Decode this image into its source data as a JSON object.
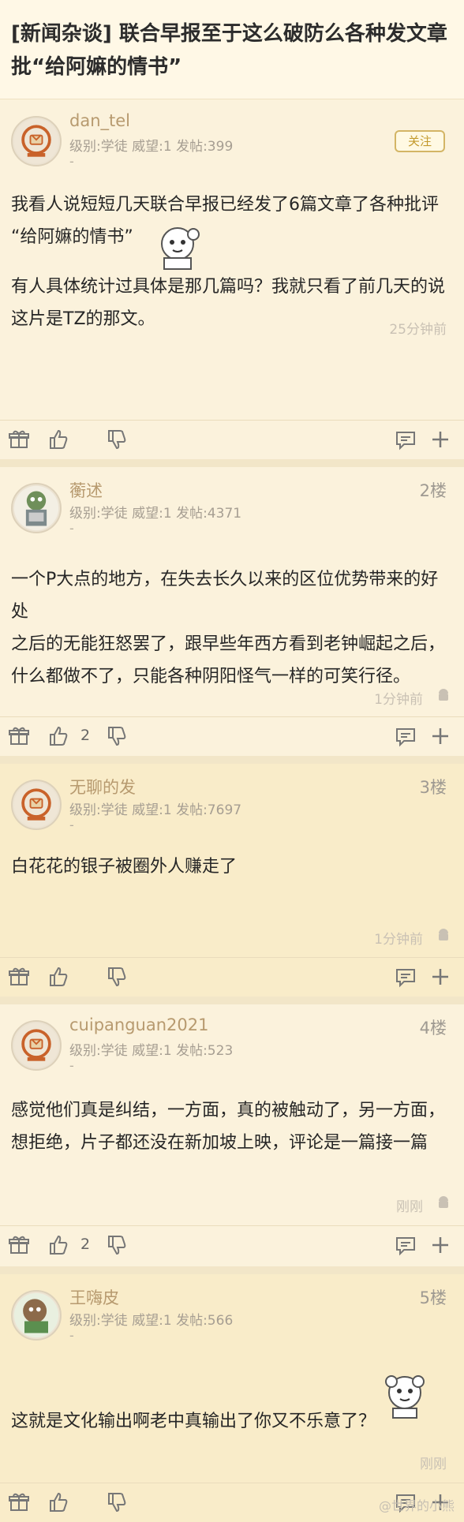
{
  "thread": {
    "title_line1": "[新闻杂谈] 联合早报至于这么破防么各种发文章",
    "title_line2": "批“给阿嫲的情书”"
  },
  "posts": [
    {
      "username": "dan_tel",
      "info": "级别:学徒 威望:1 发帖:399",
      "dash": "-",
      "follow": "关注",
      "lines": [
        "我看人说短短几天联合早报已经发了6篇文章了各种批评",
        "“给阿嫲的情书”",
        "",
        "有人具体统计过具体是那几篇吗？我就只看了前几天的说",
        "这片是TZ的那文。"
      ],
      "time": "25分钟前",
      "likes": ""
    },
    {
      "username": "蘅述",
      "info": "级别:学徒 威望:1 发帖:4371",
      "dash": "-",
      "floor": "2楼",
      "lines": [
        "一个P大点的地方，在失去长久以来的区位优势带来的好处",
        "之后的无能狂怒罢了，跟早些年西方看到老钟崛起之后，",
        "什么都做不了，只能各种阴阳怪气一样的可笑行径。"
      ],
      "time": "1分钟前",
      "likes": "2"
    },
    {
      "username": "无聊的发",
      "info": "级别:学徒 威望:1 发帖:7697",
      "dash": "-",
      "floor": "3楼",
      "lines": [
        "白花花的银子被圈外人赚走了"
      ],
      "time": "1分钟前",
      "likes": ""
    },
    {
      "username": "cuipanguan2021",
      "info": "级别:学徒 威望:1 发帖:523",
      "dash": "-",
      "floor": "4楼",
      "lines": [
        "感觉他们真是纠结，一方面，真的被触动了，另一方面，",
        "想拒绝，片子都还没在新加坡上映，评论是一篇接一篇"
      ],
      "time": "刚刚",
      "likes": "2"
    },
    {
      "username": "王嗨皮",
      "info": "级别:学徒 威望:1 发帖:566",
      "dash": "-",
      "floor": "5楼",
      "lines": [
        "这就是文化输出啊老中真输出了你又不乐意了？"
      ],
      "time": "刚刚",
      "likes": ""
    }
  ],
  "watermark": "@世界的小熊"
}
